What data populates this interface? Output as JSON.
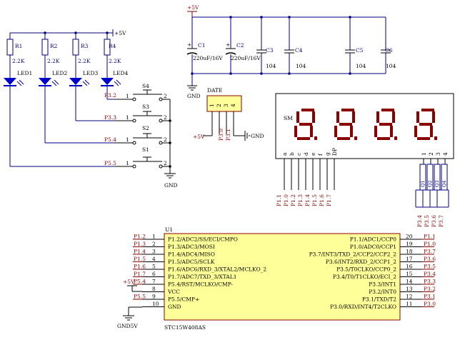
{
  "power": {
    "vcc": "+5V",
    "gnd": "GND",
    "gnd5v": "GND5V"
  },
  "resistors": [
    {
      "ref": "R1",
      "value": "2.2K"
    },
    {
      "ref": "R2",
      "value": "2.2K"
    },
    {
      "ref": "R3",
      "value": "2.2K"
    },
    {
      "ref": "R4",
      "value": "2.2K"
    }
  ],
  "leds": [
    "LED1",
    "LED2",
    "LED3",
    "LED4"
  ],
  "switches": [
    {
      "ref": "S4",
      "net": "P3.2"
    },
    {
      "ref": "S3",
      "net": "P3.3"
    },
    {
      "ref": "S2",
      "net": "P5.4"
    },
    {
      "ref": "S1",
      "net": "P5.5"
    }
  ],
  "switch_pins": {
    "p1": "1",
    "p2": "2"
  },
  "capacitors": [
    {
      "ref": "C1",
      "value": "220uF/16V"
    },
    {
      "ref": "C2",
      "value": "220uF/16V"
    },
    {
      "ref": "C3",
      "value": "104"
    },
    {
      "ref": "C4",
      "value": "104"
    },
    {
      "ref": "C5",
      "value": "104"
    },
    {
      "ref": "C6",
      "value": "104"
    }
  ],
  "date_header": {
    "label": "DATE",
    "pins": [
      "1",
      "2",
      "3",
      "4"
    ],
    "nets": [
      "P3.0",
      "P3.1"
    ]
  },
  "display": {
    "ref": "SM",
    "seg_pins": [
      "a",
      "b",
      "c",
      "d",
      "e",
      "f",
      "g",
      "DP"
    ],
    "digit_pins": [
      "1",
      "2",
      "3",
      "4"
    ],
    "seg_nets": [
      "P1.1",
      "P1.0",
      "P1.2",
      "P1.3",
      "P1.4",
      "P1.5",
      "P1.6",
      "P1.7"
    ],
    "transistors": [
      "Q1",
      "Q2",
      "Q3",
      "Q4"
    ],
    "digit_nets": [
      "P3.4",
      "P3.5",
      "P3.6",
      "P3.7"
    ]
  },
  "mcu": {
    "ref": "U1",
    "part": "STC15W408AS",
    "left": [
      {
        "net": "P1.2",
        "num": "1",
        "name": "P1.2/ADC2/SS/ECI/CMPO"
      },
      {
        "net": "P1.3",
        "num": "2",
        "name": "P1.3/ADC3/MOSI"
      },
      {
        "net": "P1.4",
        "num": "3",
        "name": "P1.4/ADC4/MISO"
      },
      {
        "net": "P1.5",
        "num": "4",
        "name": "P1.5/ADC5/SCLK"
      },
      {
        "net": "P1.6",
        "num": "5",
        "name": "P1.6/ADC6/RXD_3/XTAL2/MCLKO_2"
      },
      {
        "net": "P1.7",
        "num": "6",
        "name": "P1.7/ADC7/TXD_3/XTAL1"
      },
      {
        "net": "P5.4",
        "num": "7",
        "name": "P5.4/RST/MCLKO/CMP-"
      },
      {
        "net": "+5V",
        "num": "8",
        "name": "VCC"
      },
      {
        "net": "P5.5",
        "num": "9",
        "name": "P5.5/CMP+"
      },
      {
        "net": "GND",
        "num": "10",
        "name": "GND"
      }
    ],
    "right": [
      {
        "net": "P1.1",
        "num": "20",
        "name": "P1.1/ADC1/CCP0"
      },
      {
        "net": "P1.0",
        "num": "19",
        "name": "P1.0/ADC0/CCP1"
      },
      {
        "net": "P3.7",
        "num": "18",
        "name": "P3.7/INT3/TXD_2/CCP2/CCP2_2"
      },
      {
        "net": "P3.6",
        "num": "17",
        "name": "P3.6/INT2/RXD_2/CCP1_2"
      },
      {
        "net": "P3.5",
        "num": "16",
        "name": "P3.5/T0CLKO/CCP0_2"
      },
      {
        "net": "P3.4",
        "num": "15",
        "name": "P3.4/T0/T1CLKO/ECI_2"
      },
      {
        "net": "P3.3",
        "num": "14",
        "name": "P3.3/INT1"
      },
      {
        "net": "P3.2",
        "num": "13",
        "name": "P3.2/INT0"
      },
      {
        "net": "P3.1",
        "num": "12",
        "name": "P3.1/TXD/T2"
      },
      {
        "net": "P3.0",
        "num": "11",
        "name": "P3.0/RXD/INT4/T2CLKO"
      }
    ]
  },
  "colors": {
    "wire": "#000080",
    "net": "#8b0000",
    "ic_fill": "#ffff99",
    "led_fill": "#0000cc",
    "seg": "#8b0000",
    "display_bg": "#ffffff"
  }
}
